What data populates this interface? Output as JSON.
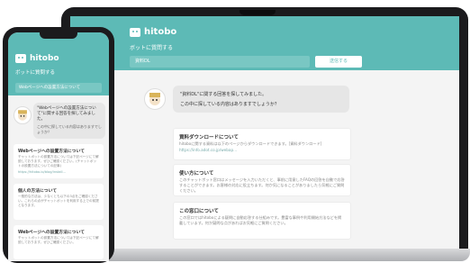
{
  "brand": {
    "name": "hitobo"
  },
  "subtitle": "ボットに質問する",
  "laptop": {
    "search_value": "資料DL",
    "submit_label": "送信する",
    "bot_message_line1": "\"資料DL\"に関する回答を探してみました。",
    "bot_message_line2": "この中に探している内容はありますでしょうか？",
    "cards": [
      {
        "title": "資料ダウンロードについて",
        "body": "hitoboに関する資料は以下のページからダウンロードできます。[資料ダウンロード]",
        "link": "https://info.adot.co.jp/webap..."
      },
      {
        "title": "使い方について",
        "body": "このチャットボット窓口はメッセージを入力いただくと、事前に用意したFAQの回答を自動で応答することができます。お客様の対応に役立ちます。何か気になることがありましたら気軽にご質問ください。",
        "link": ""
      },
      {
        "title": "この窓口について",
        "body": "この窓口ではhitoboによる疑問に自動応答する仕組みです。豊富な事例や利用開始方法などを掲載しています。何か疑問な点があればお気軽にご質問ください。",
        "link": ""
      }
    ]
  },
  "phone": {
    "search_value": "Webページへの設置方法について",
    "bot_message": "\"Webページへの設置方法について\"に関する回答を探してみました。",
    "bot_message2": "この中に探している内容はありますでしょうか？",
    "cards": [
      {
        "title": "Webページへの設置方法について",
        "body": "チャットボットの設置方法については下記ページにて解説しております。ぜひご確認ください。(チャットボットの設置方法についての記事)",
        "link": "https://hitobo.io/blog/install..."
      },
      {
        "title": "個人の方法について",
        "body": "一般的な方法は、少なくとも以下の3点をご確認ください。これらの点がチャットボットを利用する上での前提となります。",
        "link": ""
      },
      {
        "title": "Webページへの設置方法について",
        "body": "チャットボットの設置方法については下記ページにて解説しております。ぜひご確認ください。",
        "link": ""
      }
    ]
  }
}
